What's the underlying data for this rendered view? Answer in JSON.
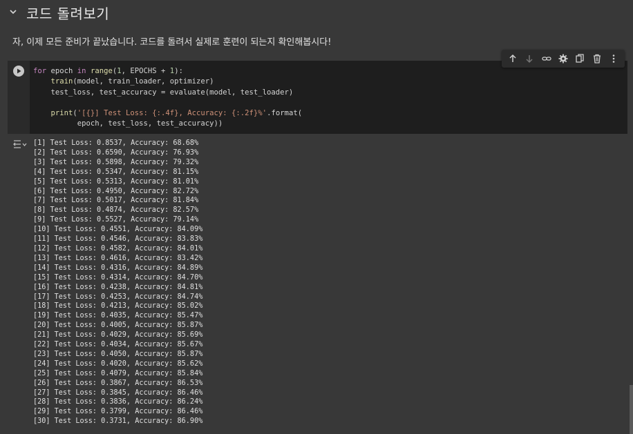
{
  "section": {
    "title": "코드 돌려보기"
  },
  "text_cell": {
    "text": "자, 이제 모든 준비가 끝났습니다. 코드를 돌려서 실제로 훈련이 되는지 확인해봅시다!"
  },
  "toolbar": {
    "icons": [
      "arrow-up-icon",
      "arrow-down-icon",
      "link-icon",
      "gear-icon",
      "mirror-cell-icon",
      "trash-icon",
      "more-vert-icon"
    ]
  },
  "code": {
    "line1": {
      "kw1": "for",
      "v1": " epoch ",
      "kw2": "in",
      "fn1": " range",
      "p1": "(",
      "n1": "1",
      "p2": ", EPOCHS + ",
      "n2": "1",
      "p3": "):"
    },
    "line2": {
      "indent": "    ",
      "fn": "train",
      "rest": "(model, train_loader, optimizer)"
    },
    "line3": {
      "indent": "    ",
      "rest": "test_loss, test_accuracy = evaluate(model, test_loader)"
    },
    "line4": {
      "text": ""
    },
    "line5": {
      "indent": "    ",
      "fn": "print",
      "p1": "(",
      "str": "'[{}] Test Loss: {:.4f}, Accuracy: {:.2f}%'",
      "rest": ".format("
    },
    "line6": {
      "indent": "          ",
      "rest": "epoch, test_loss, test_accuracy))"
    }
  },
  "output": {
    "lines": [
      "[1] Test Loss: 0.8537, Accuracy: 68.68%",
      "[2] Test Loss: 0.6590, Accuracy: 76.93%",
      "[3] Test Loss: 0.5898, Accuracy: 79.32%",
      "[4] Test Loss: 0.5347, Accuracy: 81.15%",
      "[5] Test Loss: 0.5313, Accuracy: 81.01%",
      "[6] Test Loss: 0.4950, Accuracy: 82.72%",
      "[7] Test Loss: 0.5017, Accuracy: 81.84%",
      "[8] Test Loss: 0.4874, Accuracy: 82.57%",
      "[9] Test Loss: 0.5527, Accuracy: 79.14%",
      "[10] Test Loss: 0.4551, Accuracy: 84.09%",
      "[11] Test Loss: 0.4546, Accuracy: 83.83%",
      "[12] Test Loss: 0.4582, Accuracy: 84.01%",
      "[13] Test Loss: 0.4616, Accuracy: 83.42%",
      "[14] Test Loss: 0.4316, Accuracy: 84.89%",
      "[15] Test Loss: 0.4314, Accuracy: 84.70%",
      "[16] Test Loss: 0.4238, Accuracy: 84.81%",
      "[17] Test Loss: 0.4253, Accuracy: 84.74%",
      "[18] Test Loss: 0.4213, Accuracy: 85.02%",
      "[19] Test Loss: 0.4035, Accuracy: 85.47%",
      "[20] Test Loss: 0.4005, Accuracy: 85.87%",
      "[21] Test Loss: 0.4029, Accuracy: 85.69%",
      "[22] Test Loss: 0.4034, Accuracy: 85.67%",
      "[23] Test Loss: 0.4050, Accuracy: 85.87%",
      "[24] Test Loss: 0.4020, Accuracy: 85.62%",
      "[25] Test Loss: 0.4079, Accuracy: 85.84%",
      "[26] Test Loss: 0.3867, Accuracy: 86.53%",
      "[27] Test Loss: 0.3845, Accuracy: 86.46%",
      "[28] Test Loss: 0.3836, Accuracy: 86.24%",
      "[29] Test Loss: 0.3799, Accuracy: 86.46%",
      "[30] Test Loss: 0.3731, Accuracy: 86.90%"
    ]
  },
  "colors": {
    "background": "#383838",
    "code_bg": "#1e1e1e",
    "keyword": "#c586c0",
    "function": "#dcdcaa",
    "string": "#ce9178",
    "number": "#b5cea8"
  }
}
